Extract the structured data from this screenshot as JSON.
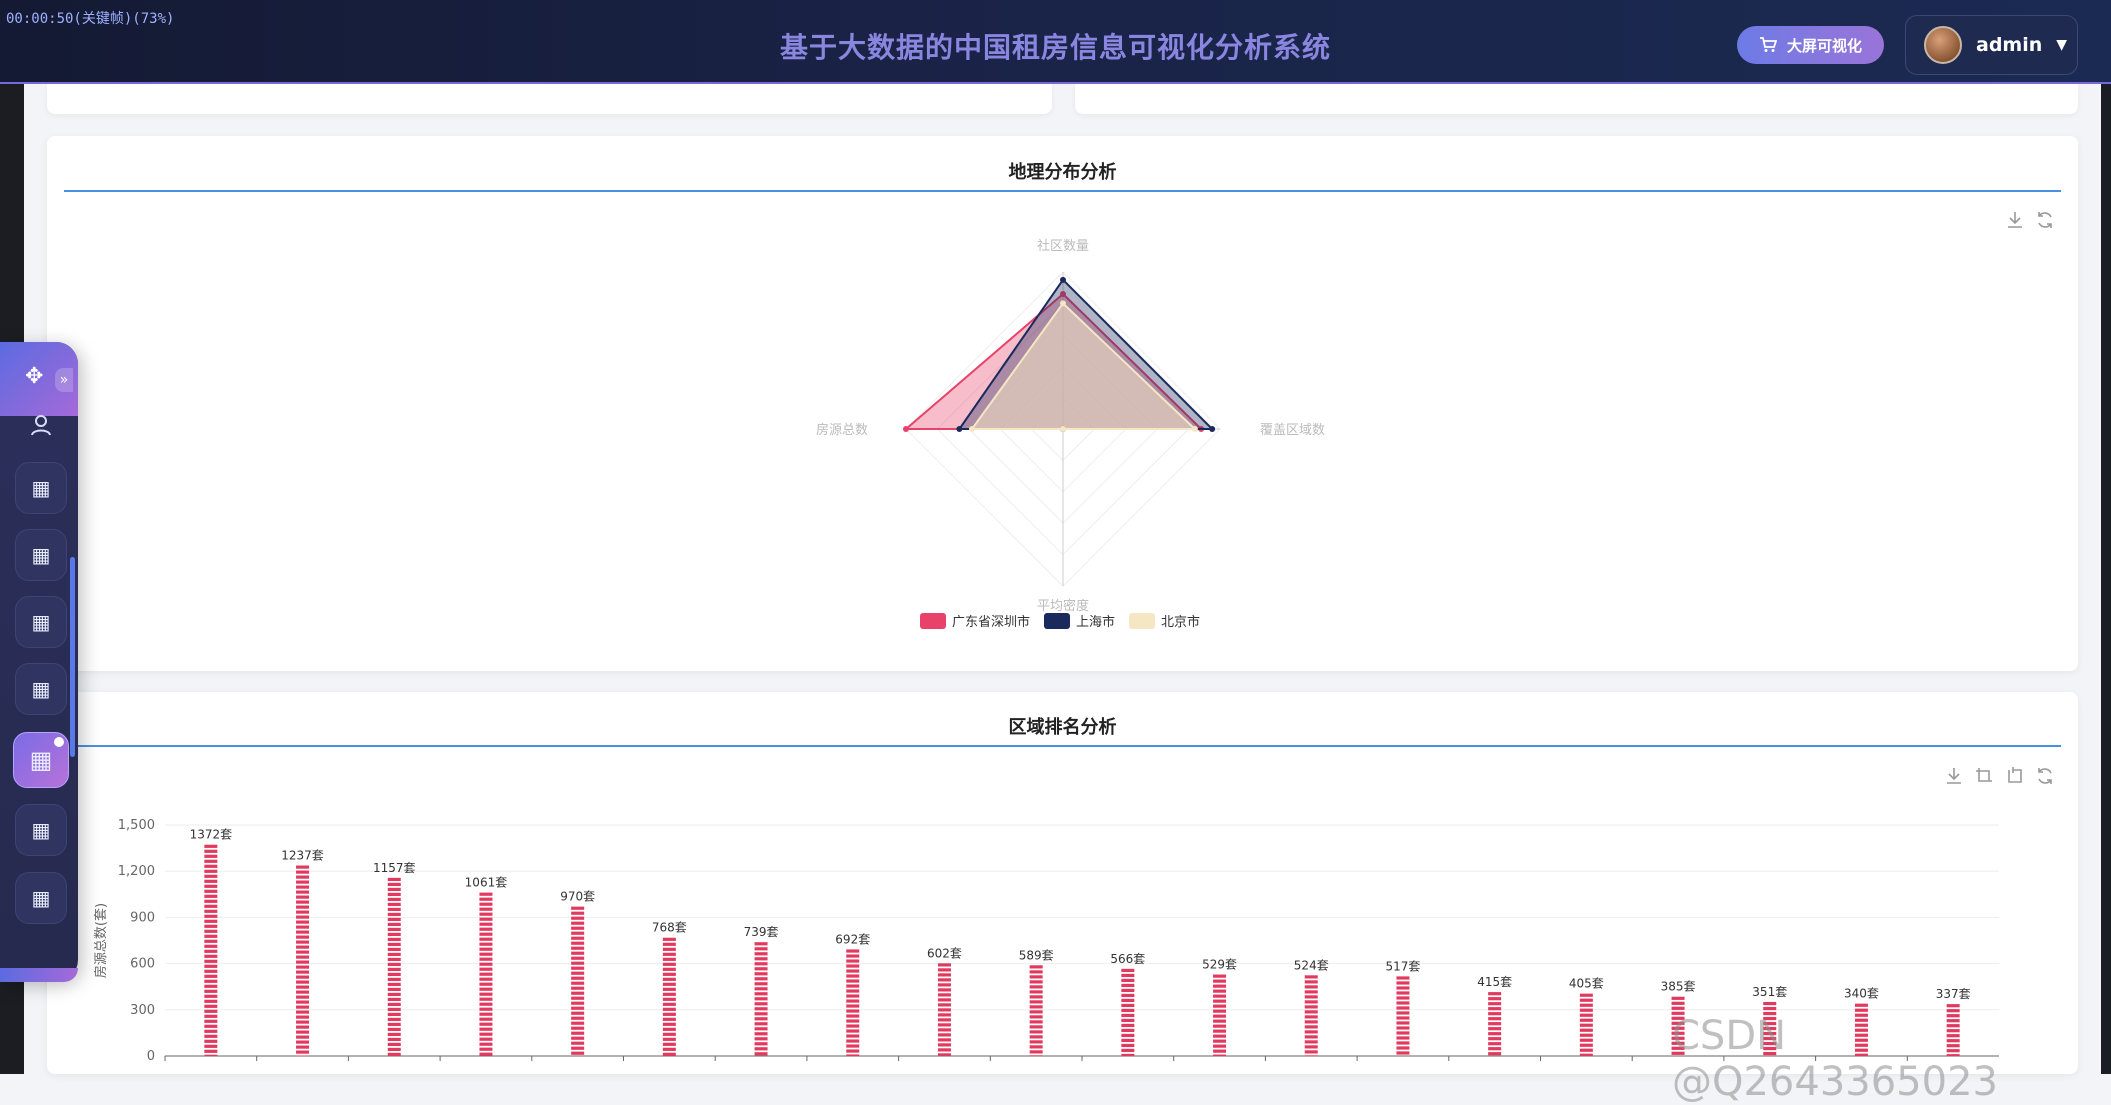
{
  "header": {
    "recording_text": "00:00:50(关键帧)(73%)",
    "title": "基于大数据的中国租房信息可视化分析系统",
    "bigscreen_label": "大屏可视化",
    "username": "admin"
  },
  "radar_card": {
    "title": "地理分布分析"
  },
  "bar_card": {
    "title": "区域排名分析"
  },
  "watermark": "CSDN @Q2643365023",
  "chart_data": [
    {
      "type": "radar",
      "indicators": [
        "社区数量",
        "覆盖区域数",
        "平均密度",
        "房源总数"
      ],
      "series": [
        {
          "name": "广东省深圳市",
          "color": "#e8426a",
          "values": [
            0.86,
            0.88,
            0.0,
            1.0
          ]
        },
        {
          "name": "上海市",
          "color": "#1a2a5c",
          "values": [
            0.95,
            0.95,
            0.0,
            0.66
          ]
        },
        {
          "name": "北京市",
          "color": "#f5e6c4",
          "values": [
            0.8,
            0.84,
            0.0,
            0.58
          ]
        }
      ]
    },
    {
      "type": "bar",
      "title": "",
      "ylabel": "房源总数(套)",
      "ylim": [
        0,
        1500
      ],
      "yticks": [
        "0",
        "300",
        "600",
        "900",
        "1,200",
        "1,500"
      ],
      "values": [
        1372,
        1237,
        1157,
        1061,
        970,
        768,
        739,
        692,
        602,
        589,
        566,
        529,
        524,
        517,
        415,
        405,
        385,
        351,
        340,
        337
      ],
      "value_labels": [
        "1372套",
        "1237套",
        "1157套",
        "1061套",
        "970套",
        "768套",
        "739套",
        "692套",
        "602套",
        "589套",
        "566套",
        "529套",
        "524套",
        "517套",
        "415套",
        "405套",
        "385套",
        "351套",
        "340套",
        "337套"
      ],
      "bar_color": "#e23a5e"
    }
  ]
}
